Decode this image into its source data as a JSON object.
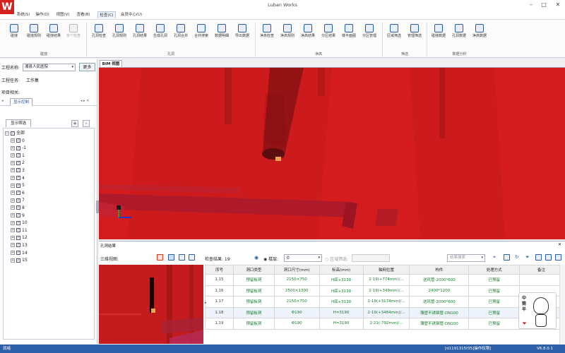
{
  "app": {
    "title": "Luban Works",
    "logo_letter": "W"
  },
  "window_controls": {
    "minimize": "–",
    "maximize": "□",
    "close": "✕"
  },
  "menu": [
    "系统(S)",
    "操作(O)",
    "视图(V)",
    "viewsys",
    "检查(C)",
    "会员中心(U)"
  ],
  "menu_labels": {
    "sys": "系统(S)",
    "op": "操作(O)",
    "view": "视图(V)",
    "tools": "查看(B)",
    "check": "检查(C)",
    "member": "会员中心(U)"
  },
  "ribbon": {
    "groups": {
      "collision": "碰撞",
      "hole": "孔洞",
      "clear": "净高",
      "filter": "筛选",
      "data": "数据分析"
    },
    "buttons": {
      "b1": "碰撞",
      "b2": "碰撞规则",
      "b3": "碰撞结果",
      "b4": "单个检查",
      "h1": "孔洞检查",
      "h2": "孔洞规则",
      "h3": "孔洞结果",
      "h4": "生成孔洞",
      "h5": "孔洞合并",
      "h6": "合并搜索",
      "h7": "数据明细",
      "h8": "导出数据",
      "c1": "净高检查",
      "c2": "净高规则",
      "c3": "净高结果",
      "c4": "分区结果",
      "c5": "楼平面图",
      "c6": "分区管理",
      "f1": "区域筛选",
      "f2": "管理筛选",
      "d1": "碰撞数据",
      "d2": "孔洞数据",
      "d3": "净高数据"
    }
  },
  "left": {
    "project_label": "工程名称:",
    "project_value": "湘县人民医院",
    "more_button": "更多",
    "task_label": "工程任务:",
    "task_value": "工作集",
    "related_label": "项目相关:",
    "tab_display": "显示控制",
    "filter_tab": "显示筛选",
    "plus": "+",
    "minus": "-",
    "tree": [
      "全部",
      "0",
      "-1",
      "1",
      "2",
      "3",
      "4",
      "5",
      "6",
      "7",
      "8",
      "9",
      "10",
      "11",
      "12",
      "13",
      "14",
      "15"
    ]
  },
  "bim": {
    "tab": "BIM 视图"
  },
  "holes": {
    "panel_title": "孔洞结果",
    "view3d_label": "三维视图:",
    "result_label": "检查结果: 19",
    "floor_label": "楼层:",
    "floor_value": "0",
    "area_label": "区域筛选:",
    "search_placeholder": "结果搜索",
    "columns": [
      "序号",
      "洞口类型",
      "洞口尺寸(mm)",
      "标高(mm)",
      "轴网位置",
      "构件",
      "处理方式",
      "备注"
    ],
    "rows": [
      [
        "1.15",
        "预留板洞",
        "2150×750",
        "H底+3130",
        "2-19(+774mm)/...",
        "送风管-2000*600",
        "已预留",
        ""
      ],
      [
        "1.16",
        "预留板洞",
        "2500×1300",
        "H底+3130",
        "2-19(+349mm)/...",
        "2400*1200",
        "已预留",
        ""
      ],
      [
        "1.17",
        "预留板洞",
        "2150×750",
        "H底+3130",
        "2-19(+3174mm)/...",
        "送风管-2000*600",
        "已预留",
        ""
      ],
      [
        "1.18",
        "预留板洞",
        "Φ190",
        "H=3190",
        "2-19(+3484mm)/...",
        "薄壁不锈钢管-DN100",
        "已预留",
        ""
      ],
      [
        "1.19",
        "预留板洞",
        "Φ190",
        "H=3190",
        "2-21(-792mm)/...",
        "薄壁不锈钢管-DN100",
        "已预留",
        ""
      ]
    ]
  },
  "mascot": {
    "text": "中\n筒\n半"
  },
  "status": {
    "left": "就绪",
    "right": "[d1191315f35]操作权限]",
    "version": "V6.8.0.1"
  }
}
